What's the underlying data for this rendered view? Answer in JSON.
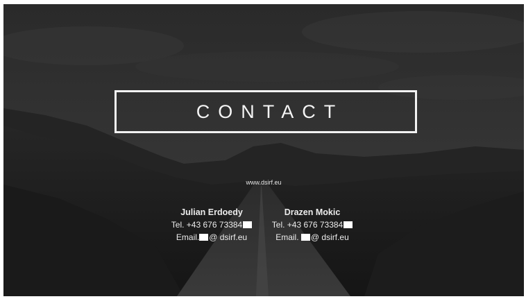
{
  "slide": {
    "title": "CONTACT",
    "website": "www.dsirf.eu",
    "contacts": [
      {
        "name": "Julian Erdoedy",
        "tel_label": "Tel.",
        "tel_number": "+43 676 73384",
        "email_label": "Email.",
        "email_domain": "@ dsirf.eu"
      },
      {
        "name": "Drazen Mokic",
        "tel_label": "Tel.",
        "tel_number": "+43 676 73384",
        "email_label": "Email.",
        "email_domain": "@ dsirf.eu"
      }
    ]
  },
  "colors": {
    "text": "#f5f5f5",
    "border": "#f2f2f2",
    "background": "#1b1b1b",
    "redaction": "#ffffff"
  }
}
